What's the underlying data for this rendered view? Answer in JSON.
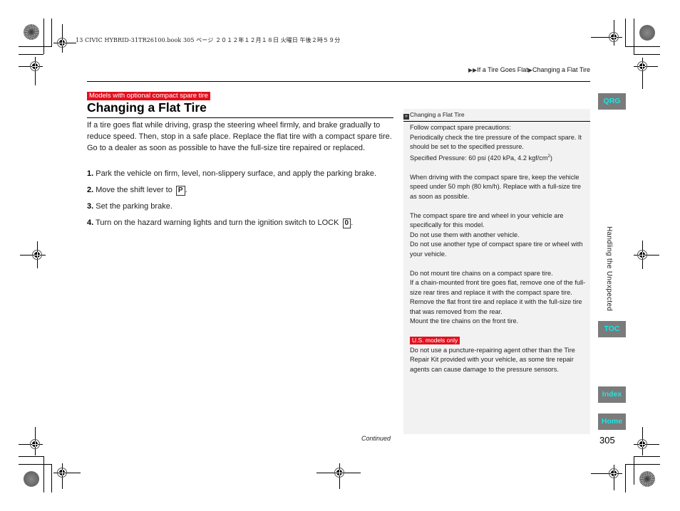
{
  "slug": "13 CIVIC HYBRID-31TR26100.book  305 ページ  ２０１２年１２月１８日  火曜日  午後２時５９分",
  "breadcrumb": {
    "items": [
      "If a Tire Goes Flat",
      "Changing a Flat Tire"
    ],
    "arrow": "▶"
  },
  "section": {
    "model_tag": "Models with optional compact spare tire",
    "title": "Changing a Flat Tire",
    "intro": "If a tire goes flat while driving, grasp the steering wheel firmly, and brake gradually to reduce speed. Then, stop in a safe place. Replace the flat tire with a compact spare tire. Go to a dealer as soon as possible to have the full-size tire repaired or replaced.",
    "steps": [
      {
        "num": "1.",
        "text": "Park the vehicle on firm, level, non-slippery surface, and apply the parking brake.",
        "key": ""
      },
      {
        "num": "2.",
        "text": "Move the shift lever to",
        "key": "P",
        "suffix": "."
      },
      {
        "num": "3.",
        "text": "Set the parking brake.",
        "key": ""
      },
      {
        "num": "4.",
        "text": "Turn on the hazard warning lights and turn the ignition switch to LOCK",
        "key": "0",
        "suffix": "."
      }
    ]
  },
  "side_note": {
    "heading_icon": "»",
    "heading": "Changing a Flat Tire",
    "para1_lines": [
      "Follow compact spare precautions:",
      "Periodically check the tire pressure of the compact spare. It should be set to the specified pressure."
    ],
    "pressure_label": "Specified Pressure: 60 psi (420 kPa, 4.2 kgf/cm",
    "pressure_sup": "2",
    "pressure_end": ")",
    "para2": "When driving with the compact spare tire, keep the vehicle speed under 50 mph (80 km/h). Replace with a full-size tire as soon as possible.",
    "para3_lines": [
      "The compact spare tire and wheel in your vehicle are specifically for this model.",
      "Do not use them with another vehicle.",
      "Do not use another type of compact spare tire or wheel with your vehicle."
    ],
    "para4_lines": [
      "Do not mount tire chains on a compact spare tire.",
      "If a chain-mounted front tire goes flat, remove one of the full-size rear tires and replace it with the compact spare tire. Remove the flat front tire and replace it with the full-size tire that was removed from the rear.",
      "Mount the tire chains on the front tire."
    ],
    "us_tag": "U.S. models only",
    "para5": "Do not use a puncture-repairing agent other than the Tire Repair Kit provided with your vehicle, as some tire repair agents can cause damage to the pressure sensors."
  },
  "footer": {
    "continued": "Continued",
    "page_number": "305"
  },
  "side_nav": {
    "qrg": "QRG",
    "toc": "TOC",
    "index": "Index",
    "home": "Home",
    "chapter_title": "Handling the Unexpected"
  },
  "colors": {
    "tag_red": "#e3101e",
    "nav_bg": "#7b7b7b",
    "nav_text": "#19e6e6",
    "panel_bg": "#f2f2f2"
  }
}
